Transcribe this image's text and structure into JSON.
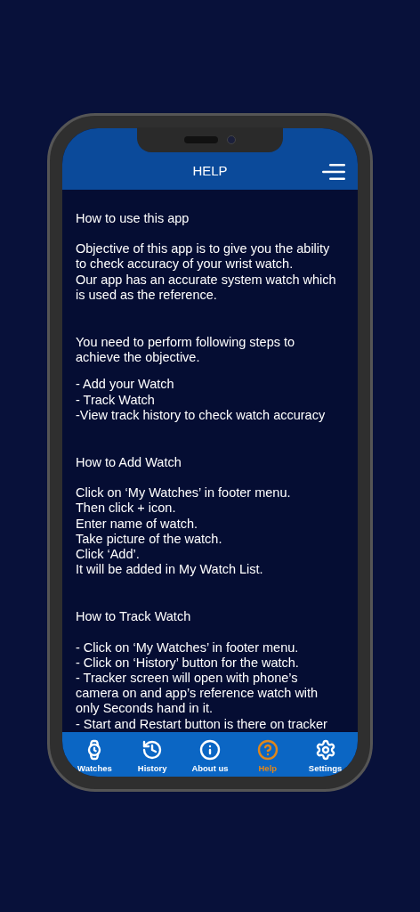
{
  "header": {
    "title": "HELP"
  },
  "sections": [
    {
      "heading": "How to use this app",
      "paragraphs": [
        [
          "Objective of this app is to give you the ability",
          "to check accuracy of your wrist watch.",
          "Our app has an accurate system watch which",
          "is used as the reference."
        ],
        [
          "You need to perform following steps to",
          "achieve the objective."
        ],
        [
          "- Add your Watch",
          "- Track Watch",
          "-View track history to check watch accuracy"
        ]
      ]
    },
    {
      "heading": "How to Add Watch",
      "paragraphs": [
        [
          "Click on ‘My Watches’ in footer menu.",
          "Then click + icon.",
          "Enter name of watch.",
          "Take picture of the watch.",
          "Click ‘Add’.",
          "It will be added in My Watch List."
        ]
      ]
    },
    {
      "heading": "How to Track Watch",
      "paragraphs": [
        [
          "- Click on ‘My Watches’ in footer menu.",
          "- Click on ‘History’ button for the watch.",
          "- Tracker screen will open with phone’s",
          "camera on and app’s reference watch with",
          "only Seconds hand in it.",
          "- Start and Restart button is there on tracker"
        ]
      ]
    }
  ],
  "footer": [
    {
      "kind": "watch",
      "label": "Watches",
      "selected": false
    },
    {
      "kind": "history",
      "label": "History",
      "selected": false
    },
    {
      "kind": "info",
      "label": "About us",
      "selected": false
    },
    {
      "kind": "help",
      "label": "Help",
      "selected": true
    },
    {
      "kind": "settings",
      "label": "Settings",
      "selected": false
    }
  ]
}
